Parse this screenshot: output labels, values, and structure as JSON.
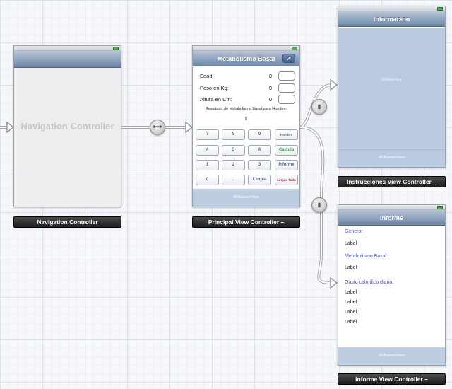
{
  "navigation_scene": {
    "placeholder_title": "Navigation Controller",
    "label": "Navigation Controller"
  },
  "principal_scene": {
    "title": "Metabolismo Basal",
    "action_icon": "share-icon",
    "fields": [
      {
        "label": "Edad:",
        "value": "0"
      },
      {
        "label": "Peso en Kg:",
        "value": "0"
      },
      {
        "label": "Altura en Cm:",
        "value": "0"
      }
    ],
    "result_label": "Resultado de Metabolismo Basal para Hombre:",
    "result_value": "0",
    "keys": [
      [
        "7",
        "8",
        "9",
        "Hombre"
      ],
      [
        "4",
        "5",
        "6",
        "Calcula"
      ],
      [
        "1",
        "2",
        "3",
        "Informe"
      ],
      [
        "0",
        ".",
        "Limpia",
        "Limpia Todo"
      ]
    ],
    "banner": "ADBannerView",
    "label": "Principal View Controller –"
  },
  "instrucciones_scene": {
    "title": "Informacion",
    "webview_label": "UIWebView",
    "banner": "ADBannerView",
    "label": "Instrucciones View Controller –"
  },
  "informe_scene": {
    "title": "Informe",
    "lines": [
      {
        "text": "Genero:",
        "style": "blue"
      },
      {
        "text": "Label",
        "style": "plain"
      },
      {
        "text": "Metabolismo Basal:",
        "style": "blue"
      },
      {
        "text": "Label",
        "style": "plain"
      },
      {
        "text": "Gasto calorifico diario:",
        "style": "blue"
      },
      {
        "text": "Label",
        "style": "plain"
      },
      {
        "text": "Label",
        "style": "plain"
      },
      {
        "text": "Label",
        "style": "plain"
      },
      {
        "text": "Label",
        "style": "plain"
      }
    ],
    "banner": "ADBannerView",
    "label": "Informe View Controller –"
  },
  "segues": {
    "relationship_symbol": "⟷",
    "push_symbol": "▮"
  },
  "colors": {
    "navbar": "#6c86a8",
    "accent_blue": "#3d4fd9",
    "green_key": "#2ea146",
    "red_key": "#c5242b",
    "banner": "#bccde2"
  }
}
